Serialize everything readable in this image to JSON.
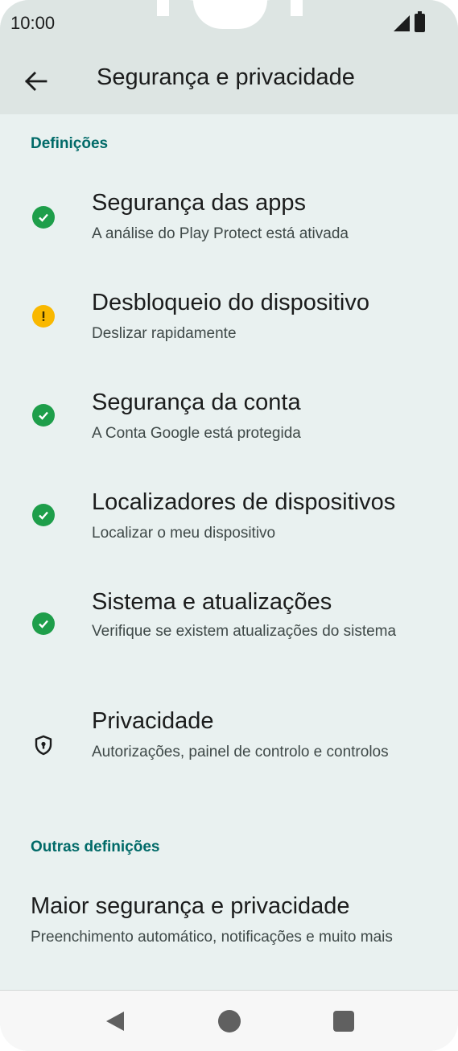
{
  "status_bar": {
    "time": "10:00"
  },
  "app_bar": {
    "title": "Segurança e privacidade"
  },
  "sections": [
    {
      "header": "Definições"
    },
    {
      "header": "Outras definições"
    }
  ],
  "items": [
    {
      "title": "Segurança das apps",
      "subtitle": "A análise do Play Protect está ativada",
      "status": "ok"
    },
    {
      "title": "Desbloqueio do dispositivo",
      "subtitle": "Deslizar rapidamente",
      "status": "warning"
    },
    {
      "title": "Segurança da conta",
      "subtitle": "A Conta Google está protegida",
      "status": "ok"
    },
    {
      "title": "Localizadores de dispositivos",
      "subtitle": "Localizar o meu dispositivo",
      "status": "ok"
    },
    {
      "title": "Sistema e atualizações",
      "subtitle": "Verifique se existem atualizações do sistema",
      "status": "ok"
    },
    {
      "title": "Privacidade",
      "subtitle": "Autorizações, painel de controlo e controlos",
      "status": "privacy"
    }
  ],
  "other_items": [
    {
      "title": "Maior segurança e privacidade",
      "subtitle": "Preenchimento automático, notificações e muito mais"
    }
  ],
  "colors": {
    "accent": "#006a68",
    "ok": "#1e9e4a",
    "warning": "#f9b800"
  }
}
